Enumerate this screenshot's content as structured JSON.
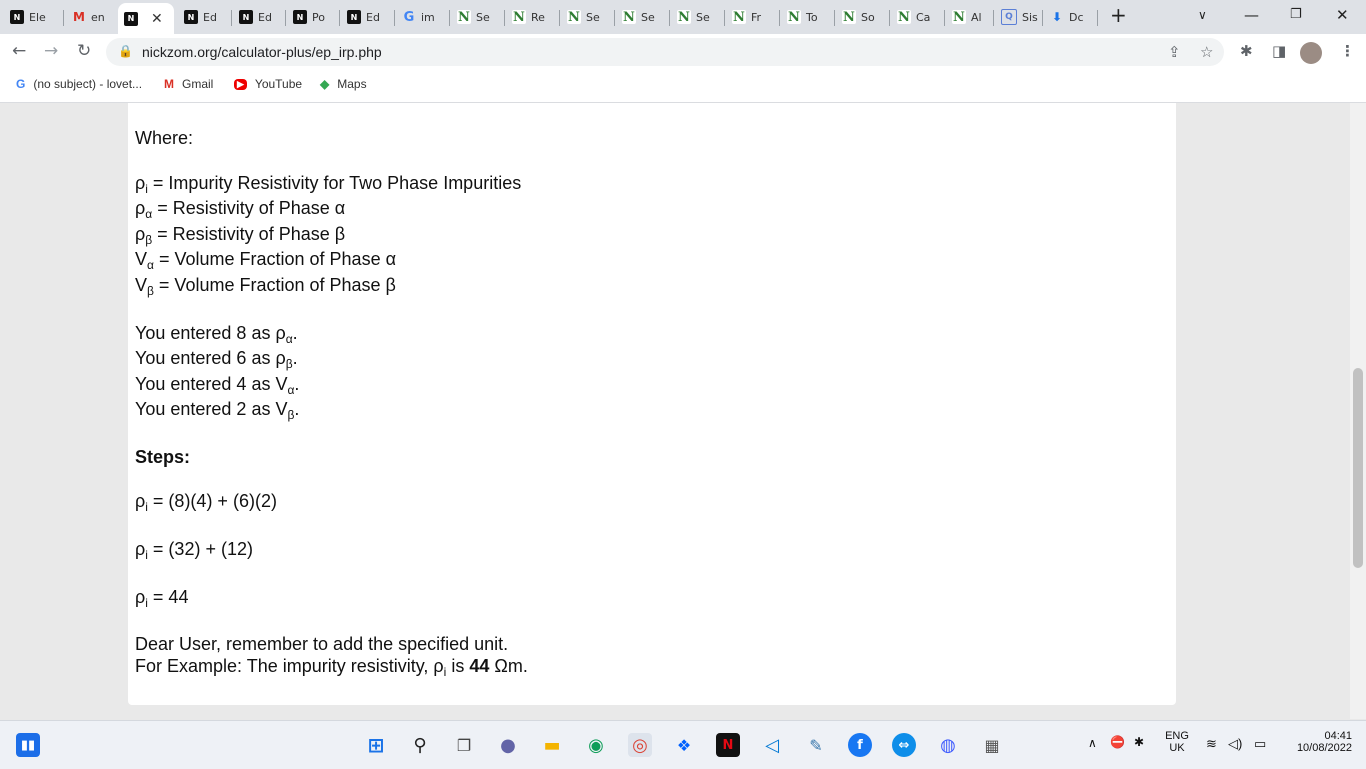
{
  "tabs": [
    {
      "label": "Ele",
      "icon": "nickzom-icon"
    },
    {
      "label": "en",
      "icon": "gmail-icon"
    },
    {
      "label": "",
      "icon": "nickzom-icon",
      "active": true
    },
    {
      "label": "Ed",
      "icon": "nickzom-icon"
    },
    {
      "label": "Ed",
      "icon": "nickzom-icon"
    },
    {
      "label": "Po",
      "icon": "nickzom-icon"
    },
    {
      "label": "Ed",
      "icon": "nickzom-icon"
    },
    {
      "label": "im",
      "icon": "google-icon"
    },
    {
      "label": "Se",
      "icon": "n-icon"
    },
    {
      "label": "Re",
      "icon": "n-icon"
    },
    {
      "label": "Se",
      "icon": "n-icon"
    },
    {
      "label": "Se",
      "icon": "n-icon"
    },
    {
      "label": "Se",
      "icon": "n-icon"
    },
    {
      "label": "Fr",
      "icon": "n-icon"
    },
    {
      "label": "To",
      "icon": "n-icon"
    },
    {
      "label": "So",
      "icon": "n-icon"
    },
    {
      "label": "Ca",
      "icon": "n-icon"
    },
    {
      "label": "Al",
      "icon": "n-icon"
    },
    {
      "label": "Sis",
      "icon": "sis-icon"
    },
    {
      "label": "Dc",
      "icon": "download-icon"
    }
  ],
  "address": {
    "url": "nickzom.org/calculator-plus/ep_irp.php"
  },
  "bookmarks": [
    {
      "label": "(no subject) - lovet...",
      "icon": "G"
    },
    {
      "label": "Gmail",
      "icon": "M"
    },
    {
      "label": "YouTube",
      "icon": "▶"
    },
    {
      "label": "Maps",
      "icon": "◆"
    }
  ],
  "content": {
    "where": "Where:",
    "defs": [
      {
        "sym": "ρ",
        "sub": "i",
        "text": " = Impurity Resistivity for Two Phase Impurities"
      },
      {
        "sym": "ρ",
        "sub": "α",
        "text": " = Resistivity of Phase α"
      },
      {
        "sym": "ρ",
        "sub": "β",
        "text": " = Resistivity of Phase β"
      },
      {
        "sym": "V",
        "sub": "α",
        "text": " = Volume Fraction of Phase α"
      },
      {
        "sym": "V",
        "sub": "β",
        "text": " = Volume Fraction of Phase β"
      }
    ],
    "entered": [
      {
        "pre": "You entered 8 as ",
        "sym": "ρ",
        "sub": "α",
        "post": "."
      },
      {
        "pre": "You entered 6 as ",
        "sym": "ρ",
        "sub": "β",
        "post": "."
      },
      {
        "pre": "You entered 4 as ",
        "sym": "V",
        "sub": "α",
        "post": "."
      },
      {
        "pre": "You entered 2 as ",
        "sym": "V",
        "sub": "β",
        "post": "."
      }
    ],
    "steps_title": "Steps:",
    "steps": [
      {
        "sym": "ρ",
        "sub": "i",
        "text": " = (8)(4) + (6)(2)"
      },
      {
        "sym": "ρ",
        "sub": "i",
        "text": " = (32) + (12)"
      },
      {
        "sym": "ρ",
        "sub": "i",
        "text": " = 44"
      }
    ],
    "note1": "Dear User, remember to add the specified unit.",
    "note2_pre": "For Example: The impurity resistivity, ",
    "note2_sym": "ρ",
    "note2_sub": "i",
    "note2_mid": " is ",
    "note2_val": "44",
    "note2_unit": " Ωm."
  },
  "taskbar": {
    "lang1": "ENG",
    "lang2": "UK",
    "time": "04:41",
    "date": "10/08/2022"
  }
}
